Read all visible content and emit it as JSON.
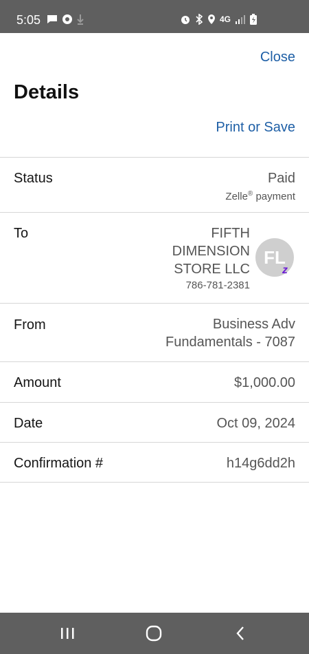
{
  "status_bar": {
    "time": "5:05",
    "left_icons": [
      "message-icon",
      "app-icon",
      "download-icon"
    ],
    "right_icons": [
      "alarm-icon",
      "bluetooth-icon",
      "location-icon",
      "4g-lte-icon",
      "signal-icon",
      "battery-charging-icon"
    ],
    "network_label": "4G"
  },
  "header": {
    "close_label": "Close",
    "title": "Details",
    "print_save_label": "Print or Save"
  },
  "rows": {
    "status": {
      "label": "Status",
      "value": "Paid",
      "sub_text": "Zelle",
      "sub_mark": "®",
      "sub_suffix": " payment"
    },
    "to": {
      "label": "To",
      "name": "FIFTH DIMENSION STORE LLC",
      "phone": "786-781-2381",
      "avatar_initials": "FL",
      "badge": "z"
    },
    "from": {
      "label": "From",
      "value_line1": "Business Adv",
      "value_line2": "Fundamentals - 7087"
    },
    "amount": {
      "label": "Amount",
      "value": "$1,000.00"
    },
    "date": {
      "label": "Date",
      "value": "Oct 09, 2024"
    },
    "confirmation": {
      "label": "Confirmation #",
      "value": "h14g6dd2h"
    }
  },
  "nav": {
    "buttons": [
      "recent-apps-icon",
      "home-icon",
      "back-icon"
    ]
  },
  "colors": {
    "link": "#1e5fa6",
    "status_bar": "#5f5f5f",
    "zelle": "#6d1ed4"
  }
}
